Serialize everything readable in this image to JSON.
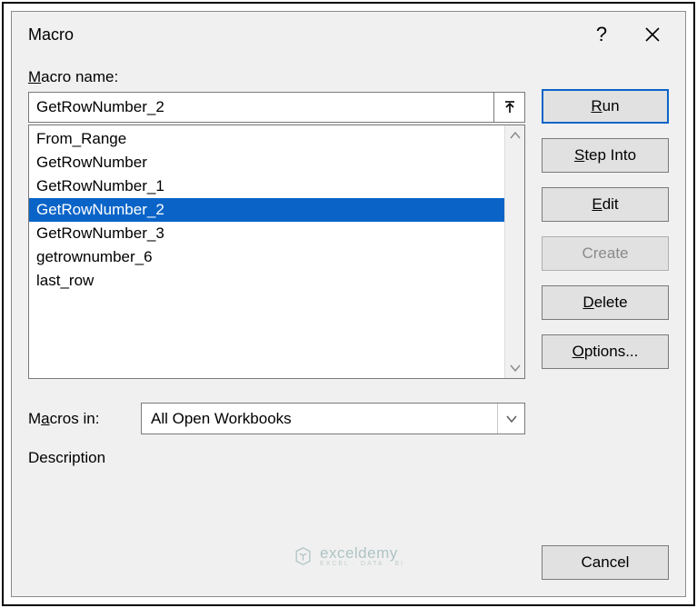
{
  "titlebar": {
    "title": "Macro",
    "help_label": "?",
    "close_label": "Close"
  },
  "labels": {
    "macro_name_pre": "M",
    "macro_name_post": "acro name:",
    "macros_in": "Macros in:",
    "macros_in_pre": "M",
    "macros_in_u": "a",
    "macros_in_post": "cros in:",
    "description": "Description"
  },
  "macro_name_value": "GetRowNumber_2",
  "list_items": [
    {
      "label": "From_Range",
      "selected": false
    },
    {
      "label": "GetRowNumber",
      "selected": false
    },
    {
      "label": "GetRowNumber_1",
      "selected": false
    },
    {
      "label": "GetRowNumber_2",
      "selected": true
    },
    {
      "label": "GetRowNumber_3",
      "selected": false
    },
    {
      "label": "getrownumber_6",
      "selected": false
    },
    {
      "label": "last_row",
      "selected": false
    }
  ],
  "macros_in_value": "All Open Workbooks",
  "buttons": {
    "run_u": "R",
    "run_post": "un",
    "step_u": "S",
    "step_post": "tep Into",
    "edit_u": "E",
    "edit_post": "dit",
    "create": "Create",
    "delete_u": "D",
    "delete_post": "elete",
    "options_u": "O",
    "options_post": "ptions...",
    "cancel": "Cancel"
  },
  "watermark": {
    "title": "exceldemy",
    "sub": "EXCEL · DATA · BI"
  }
}
